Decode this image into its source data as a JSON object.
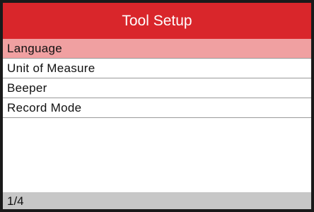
{
  "header": {
    "title": "Tool Setup"
  },
  "menu": {
    "selected_index": 0,
    "items": [
      {
        "label": "Language"
      },
      {
        "label": "Unit of Measure"
      },
      {
        "label": "Beeper"
      },
      {
        "label": "Record Mode"
      }
    ]
  },
  "footer": {
    "page_indicator": "1/4"
  },
  "colors": {
    "title_bar": "#d9262b",
    "selected_row": "#f0a0a1",
    "status_bar": "#c7c7c7"
  }
}
